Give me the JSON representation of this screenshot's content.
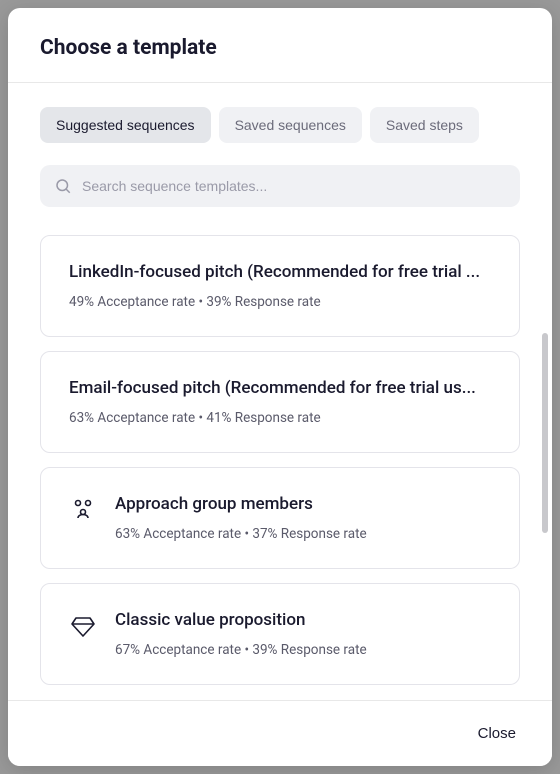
{
  "header": {
    "title": "Choose a template"
  },
  "tabs": [
    {
      "label": "Suggested sequences",
      "active": true
    },
    {
      "label": "Saved sequences",
      "active": false
    },
    {
      "label": "Saved steps",
      "active": false
    }
  ],
  "search": {
    "placeholder": "Search sequence templates..."
  },
  "templates": [
    {
      "title": "LinkedIn-focused pitch (Recommended for free trial ...",
      "stats": "49% Acceptance rate • 39% Response rate",
      "icon": null
    },
    {
      "title": "Email-focused pitch (Recommended for free trial us...",
      "stats": "63% Acceptance rate • 41% Response rate",
      "icon": null
    },
    {
      "title": "Approach group members",
      "stats": "63% Acceptance rate • 37% Response rate",
      "icon": "group"
    },
    {
      "title": "Classic value proposition",
      "stats": "67% Acceptance rate • 39% Response rate",
      "icon": "diamond"
    }
  ],
  "footer": {
    "close_label": "Close"
  }
}
